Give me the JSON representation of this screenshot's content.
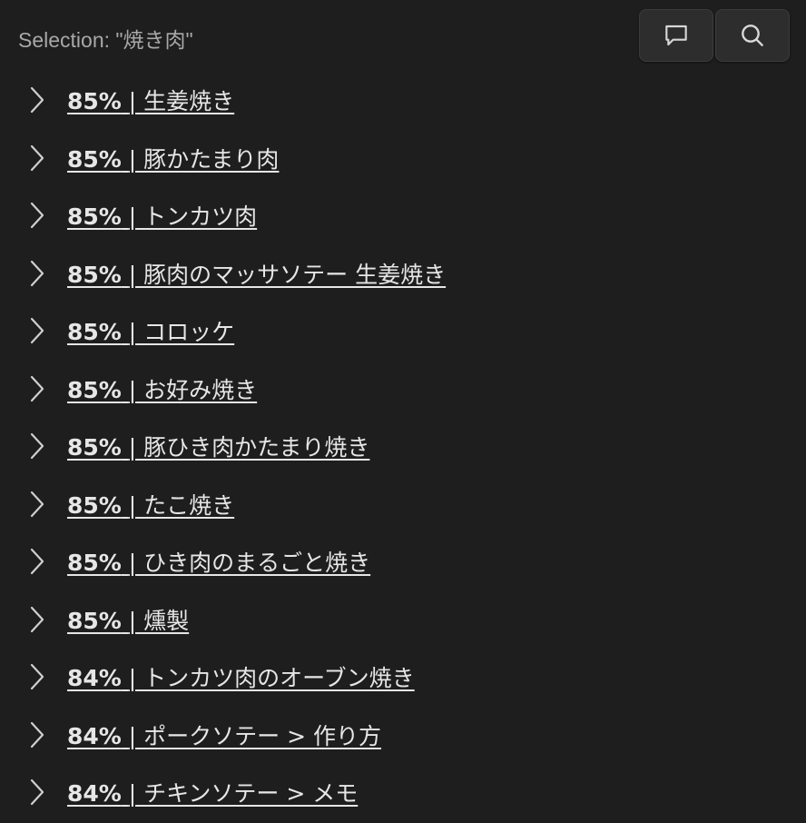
{
  "header": {
    "selection_text": "Selection: \"焼き肉\""
  },
  "toolbar": {
    "chat_icon": "message-square-icon",
    "search_icon": "search-icon"
  },
  "results": [
    {
      "score": "85%",
      "title": "| 生姜焼き"
    },
    {
      "score": "85%",
      "title": "| 豚かたまり肉"
    },
    {
      "score": "85%",
      "title": "| トンカツ肉"
    },
    {
      "score": "85%",
      "title": "| 豚肉のマッサソテー 生姜焼き"
    },
    {
      "score": "85%",
      "title": "| コロッケ"
    },
    {
      "score": "85%",
      "title": "| お好み焼き"
    },
    {
      "score": "85%",
      "title": "| 豚ひき肉かたまり焼き"
    },
    {
      "score": "85%",
      "title": "| たこ焼き"
    },
    {
      "score": "85%",
      "title": "| ひき肉のまるごと焼き"
    },
    {
      "score": "85%",
      "title": "| 燻製"
    },
    {
      "score": "84%",
      "title": "| トンカツ肉のオーブン焼き"
    },
    {
      "score": "84%",
      "title": "| ポークソテー > 作り方"
    },
    {
      "score": "84%",
      "title": "| チキンソテー > メモ"
    }
  ],
  "colors": {
    "background": "#1e1e1e",
    "link": "#e6e6e6",
    "muted": "#a8a8a8",
    "button_bg": "#2d2d2d"
  }
}
